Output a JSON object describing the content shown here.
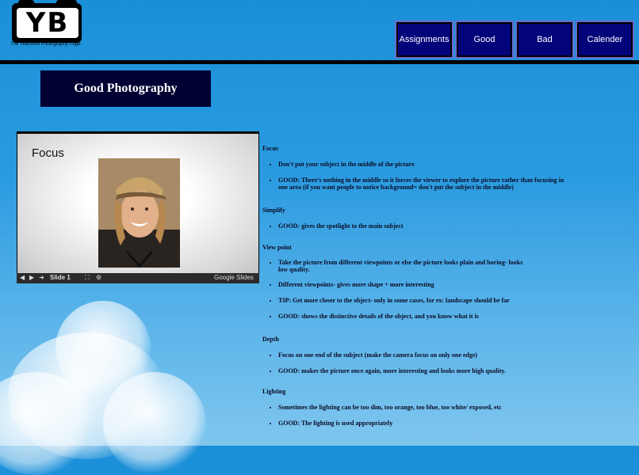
{
  "logo": {
    "letters": "YB",
    "caption": "The Yearbook Photography Page"
  },
  "nav": {
    "items": [
      "Assignments",
      "Good",
      "Bad",
      "Calender"
    ]
  },
  "page_title": "Good Photography",
  "slide": {
    "title": "Focus",
    "slide_label": "Slide 1",
    "brand": "Google Slides"
  },
  "sections": [
    {
      "heading": "Focus",
      "items": [
        "Don't put your subject in the middle of the picture",
        "GOOD: There's nothing in the middle so it forces the viewer to explore the picture rather than focusing in one area (if you want people to notice background= don't put the subject in the middle)"
      ]
    },
    {
      "heading": "Simplify",
      "items": [
        "GOOD: gives the spotlight to the main subject"
      ]
    },
    {
      "heading": "View point",
      "items": [
        "Take the picture from different viewpoints or else the picture looks plain and boring- looks low quality.",
        "Different viewpoints- gives more shape + more interesting",
        "TIP: Get more closer to the object- only in some cases, for ex: landscape should be far",
        "GOOD: shows the distinctive details of the object, and you know what it is"
      ]
    },
    {
      "heading": "Depth",
      "items": [
        "Focus on one end of the subject (make the camera focus on only one edge)",
        "GOOD: makes the picture once again, more interesting and looks more high quality."
      ]
    },
    {
      "heading": "Lighting",
      "items": [
        "Sometimes the lighting can be too dim, too orange, too blue, too white/ exposed, etc",
        "GOOD: The lighting is used appropriately"
      ]
    }
  ]
}
